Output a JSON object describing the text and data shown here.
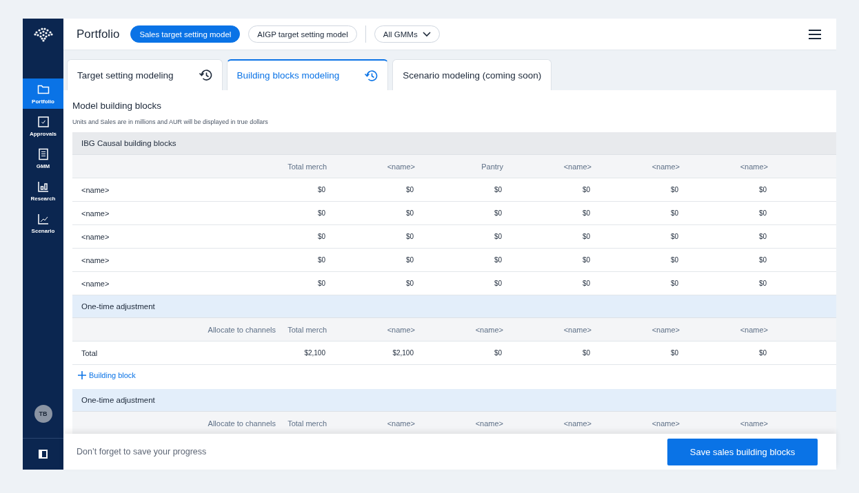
{
  "sidebar": {
    "items": [
      {
        "label": "Portfolio",
        "kind": "folder",
        "selected": true
      },
      {
        "label": "Approvals",
        "kind": "check",
        "selected": false
      },
      {
        "label": "GMM",
        "kind": "list",
        "selected": false
      },
      {
        "label": "Research",
        "kind": "bars",
        "selected": false
      },
      {
        "label": "Scenario",
        "kind": "trend",
        "selected": false
      }
    ],
    "avatar": "TB"
  },
  "header": {
    "title": "Portfolio",
    "models": [
      {
        "label": "Sales target setting model",
        "selected": true
      },
      {
        "label": "AIGP target setting model",
        "selected": false
      }
    ],
    "dropdown": "All GMMs"
  },
  "tabs": [
    {
      "label": "Target setting modeling",
      "selected": false,
      "history": true
    },
    {
      "label": "Building blocks modeling",
      "selected": true,
      "history": true
    },
    {
      "label": "Scenario modeling (coming soon)",
      "selected": false,
      "history": false
    }
  ],
  "page": {
    "title": "Model building blocks",
    "note": "Units and Sales are in millions and AUR will be displayed in true dollars"
  },
  "sections": [
    {
      "kind": "causal",
      "title": "IBG Causal building blocks",
      "columns": [
        "Total merch",
        "<name>",
        "Pantry",
        "<name>",
        "<name>",
        "<name>"
      ],
      "rows": [
        {
          "name": "<name>",
          "values": [
            "$0",
            "$0",
            "$0",
            "$0",
            "$0",
            "$0"
          ]
        },
        {
          "name": "<name>",
          "values": [
            "$0",
            "$0",
            "$0",
            "$0",
            "$0",
            "$0"
          ]
        },
        {
          "name": "<name>",
          "values": [
            "$0",
            "$0",
            "$0",
            "$0",
            "$0",
            "$0"
          ]
        },
        {
          "name": "<name>",
          "values": [
            "$0",
            "$0",
            "$0",
            "$0",
            "$0",
            "$0"
          ]
        },
        {
          "name": "<name>",
          "values": [
            "$0",
            "$0",
            "$0",
            "$0",
            "$0",
            "$0"
          ]
        }
      ]
    },
    {
      "kind": "adjustment",
      "title": "One-time adjustment",
      "allocate": "Allocate to channels",
      "columns": [
        "Total merch",
        "<name>",
        "<name>",
        "<name>",
        "<name>",
        "<name>"
      ],
      "rows": [
        {
          "name": "Total",
          "values": [
            "$2,100",
            "$2,100",
            "$0",
            "$0",
            "$0",
            "$0"
          ]
        }
      ],
      "add": "Building block"
    },
    {
      "kind": "adjustment",
      "title": "One-time adjustment",
      "allocate": "Allocate to channels",
      "columns": [
        "Total merch",
        "<name>",
        "<name>",
        "<name>",
        "<name>",
        "<name>"
      ]
    }
  ],
  "footer": {
    "note": "Don’t forget to save your progress",
    "button": "Save sales building blocks"
  }
}
